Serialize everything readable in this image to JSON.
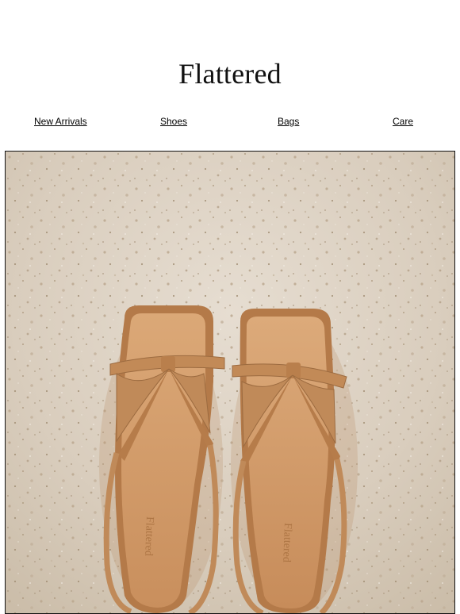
{
  "brand": {
    "name": "Flattered"
  },
  "nav": {
    "items": [
      {
        "label": "New Arrivals"
      },
      {
        "label": "Shoes"
      },
      {
        "label": "Bags"
      },
      {
        "label": "Care"
      }
    ]
  },
  "hero": {
    "image": "tan-leather-strappy-sandals-on-terrazzo",
    "insole_brand_text": "Flattered"
  },
  "colors": {
    "background": "#ffffff",
    "terrazzo": "#ddd2c4",
    "leather": "#c08a59",
    "leather_dark": "#9c6b40",
    "insole": "#d9a475"
  }
}
